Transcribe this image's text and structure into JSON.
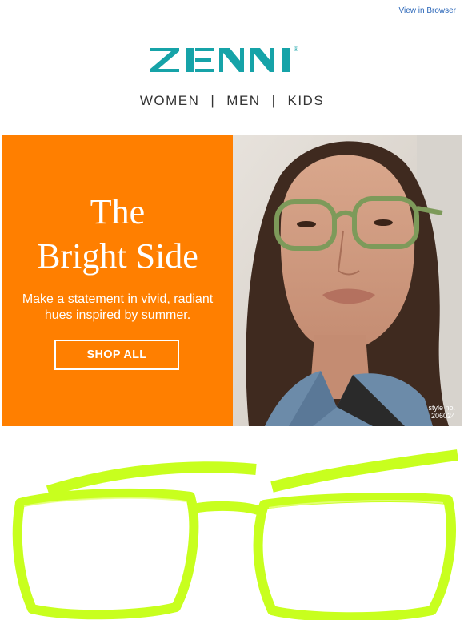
{
  "header": {
    "view_in_browser": "View in Browser",
    "brand": "ZENNI",
    "registered_mark": "®"
  },
  "nav": {
    "items": [
      "WOMEN",
      "MEN",
      "KIDS"
    ],
    "separator": "|"
  },
  "hero": {
    "title_line1": "The",
    "title_line2": "Bright Side",
    "subtitle": "Make a statement in vivid, radiant hues inspired by summer.",
    "cta": "SHOP ALL",
    "style_label": "style no.",
    "style_number": "206024",
    "background_color": "#ff7f00"
  },
  "colors": {
    "brand_teal": "#16a3a8",
    "product_neon": "#c8ff1e"
  },
  "icons": {
    "logo": "zenni-logo"
  }
}
